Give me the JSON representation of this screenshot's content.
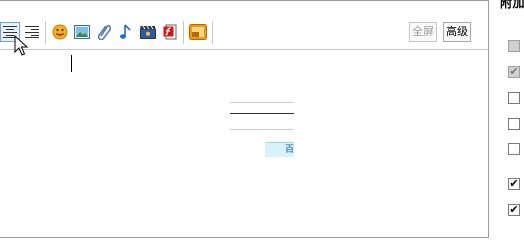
{
  "toolbar": {
    "fullscreen_label": "全屏",
    "advanced_label": "高级"
  },
  "sidebar": {
    "title": "附加",
    "checkboxes": [
      {
        "checked": false,
        "disabled": true
      },
      {
        "checked": true,
        "disabled": true
      },
      {
        "checked": false,
        "disabled": false
      },
      {
        "checked": false,
        "disabled": false
      },
      {
        "checked": false,
        "disabled": false
      },
      {
        "checked": true,
        "disabled": false
      },
      {
        "checked": true,
        "disabled": false
      }
    ]
  },
  "content": {
    "cell_fragment": "百"
  },
  "colors": {
    "active_border": "#6fa3d6",
    "cell_bg": "#d7f2fb"
  }
}
